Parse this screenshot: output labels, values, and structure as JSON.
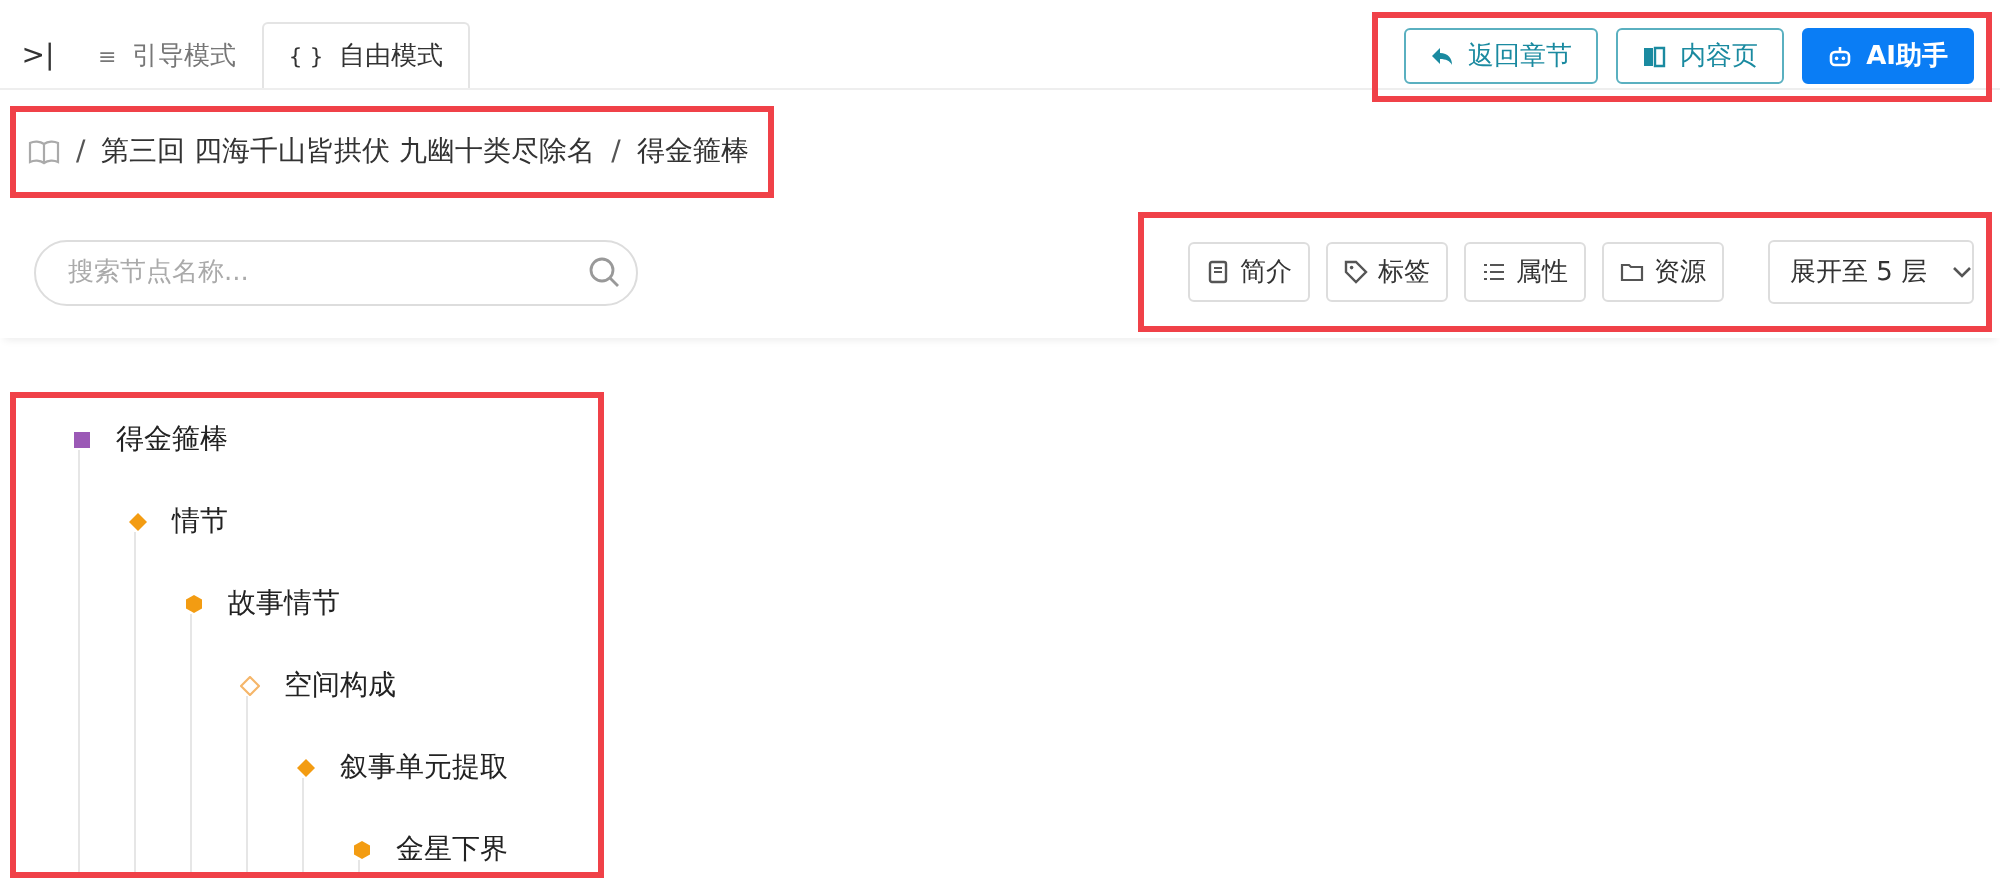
{
  "sidebar_toggle": ">|",
  "tabs": [
    {
      "label": "引导模式",
      "icon": "≡",
      "selected": false
    },
    {
      "label": "自由模式",
      "icon": "{ }",
      "selected": true
    }
  ],
  "header_actions": {
    "highlighted": true,
    "buttons": [
      {
        "label": "返回章节",
        "kind": "back"
      },
      {
        "label": "内容页",
        "kind": "book"
      },
      {
        "label": "AI助手",
        "kind": "ai"
      }
    ]
  },
  "breadcrumb": {
    "highlighted": true,
    "separator": "/",
    "items": [
      "第三回 四海千山皆拱伏 九幽十类尽除名",
      "得金箍棒"
    ]
  },
  "search": {
    "placeholder": "搜索节点名称..."
  },
  "toolbar": {
    "highlighted": true,
    "buttons": [
      {
        "label": "简介",
        "kind": "doc"
      },
      {
        "label": "标签",
        "kind": "tag"
      },
      {
        "label": "属性",
        "kind": "list"
      },
      {
        "label": "资源",
        "kind": "folder"
      }
    ],
    "depth_select": "展开至 5 层"
  },
  "tree": {
    "highlighted": true,
    "root": {
      "label": "得金箍棒",
      "kind": "square",
      "color": "#9b59b6",
      "children": [
        {
          "label": "情节",
          "kind": "diamond",
          "color": "#f39c12",
          "children": [
            {
              "label": "故事情节",
              "kind": "hexagon",
              "color": "#f39c12",
              "children": [
                {
                  "label": "空间构成",
                  "kind": "hollow",
                  "color": "#f5b66a",
                  "children": [
                    {
                      "label": "叙事单元提取",
                      "kind": "diamond",
                      "color": "#f39c12",
                      "children": [
                        {
                          "label": "金星下界",
                          "kind": "hexagon",
                          "color": "#f39c12"
                        }
                      ]
                    }
                  ]
                }
              ]
            }
          ]
        }
      ]
    }
  }
}
